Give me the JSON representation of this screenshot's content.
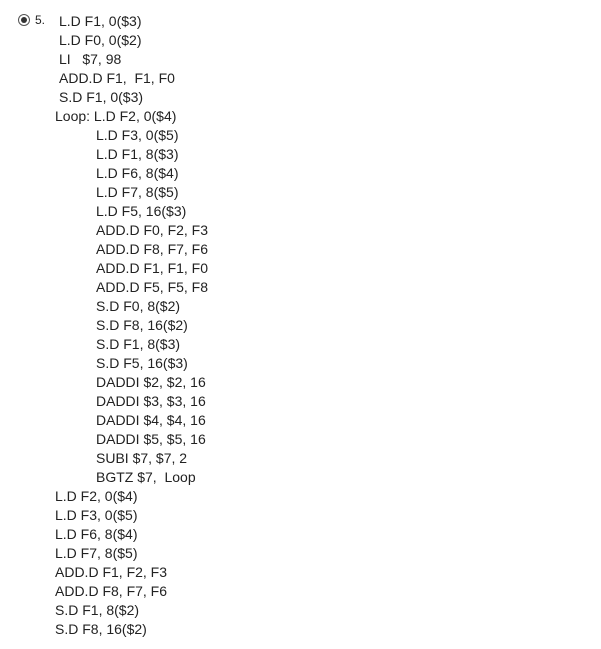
{
  "question": {
    "number_label": "5.",
    "selected": true,
    "lines": [
      {
        "text": "L.D F1, 0($3)",
        "indent": 0
      },
      {
        "text": "L.D F0, 0($2)",
        "indent": 0
      },
      {
        "text": "LI   $7, 98",
        "indent": 0
      },
      {
        "text": "ADD.D F1,  F1, F0",
        "indent": 0
      },
      {
        "text": "S.D F1, 0($3)",
        "indent": 0
      },
      {
        "text": "Loop: L.D F2, 0($4)",
        "indent": -1
      },
      {
        "text": "L.D F3, 0($5)",
        "indent": 1
      },
      {
        "text": "L.D F1, 8($3)",
        "indent": 1
      },
      {
        "text": "L.D F6, 8($4)",
        "indent": 1
      },
      {
        "text": "L.D F7, 8($5)",
        "indent": 1
      },
      {
        "text": "L.D F5, 16($3)",
        "indent": 1
      },
      {
        "text": "ADD.D F0, F2, F3",
        "indent": 1
      },
      {
        "text": "ADD.D F8, F7, F6",
        "indent": 1
      },
      {
        "text": "ADD.D F1, F1, F0",
        "indent": 1
      },
      {
        "text": "ADD.D F5, F5, F8",
        "indent": 1
      },
      {
        "text": "S.D F0, 8($2)",
        "indent": 1
      },
      {
        "text": "S.D F8, 16($2)",
        "indent": 1
      },
      {
        "text": "S.D F1, 8($3)",
        "indent": 1
      },
      {
        "text": "S.D F5, 16($3)",
        "indent": 1
      },
      {
        "text": "DADDI $2, $2, 16",
        "indent": 1
      },
      {
        "text": "DADDI $3, $3, 16",
        "indent": 1
      },
      {
        "text": "DADDI $4, $4, 16",
        "indent": 1
      },
      {
        "text": "DADDI $5, $5, 16",
        "indent": 1
      },
      {
        "text": "SUBI $7, $7, 2",
        "indent": 1
      },
      {
        "text": "BGTZ $7,  Loop",
        "indent": 1
      },
      {
        "text": "L.D F2, 0($4)",
        "indent": -1
      },
      {
        "text": "L.D F3, 0($5)",
        "indent": -1
      },
      {
        "text": "L.D F6, 8($4)",
        "indent": -1
      },
      {
        "text": "L.D F7, 8($5)",
        "indent": -1
      },
      {
        "text": "ADD.D F1, F2, F3",
        "indent": -1
      },
      {
        "text": "ADD.D F8, F7, F6",
        "indent": -1
      },
      {
        "text": "S.D F1, 8($2)",
        "indent": -1
      },
      {
        "text": "S.D F8, 16($2)",
        "indent": -1
      }
    ]
  }
}
